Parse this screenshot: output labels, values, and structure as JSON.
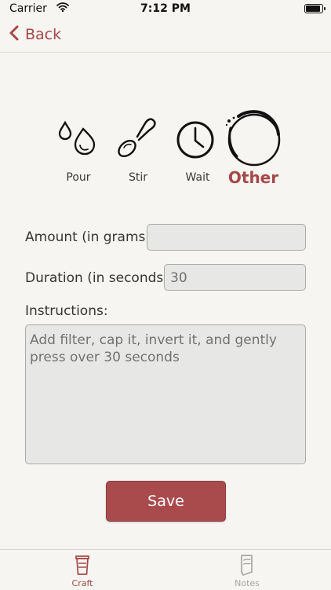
{
  "status_bar": {
    "carrier": "Carrier",
    "time": "7:12 PM"
  },
  "navigation": {
    "back_label": "Back"
  },
  "step_types": [
    {
      "label": "Pour",
      "icon": "drops-icon"
    },
    {
      "label": "Stir",
      "icon": "spoon-icon"
    },
    {
      "label": "Wait",
      "icon": "clock-icon"
    },
    {
      "label": "Other",
      "icon": "coffee-ring-icon",
      "selected": true
    }
  ],
  "form": {
    "amount_label": "Amount (in grams):",
    "amount_value": "",
    "duration_label": "Duration (in seconds):",
    "duration_value": "30",
    "instructions_label": "Instructions:",
    "instructions_value": "Add filter, cap it, invert it, and gently press over 30 seconds"
  },
  "actions": {
    "save_label": "Save"
  },
  "tabs": [
    {
      "label": "Craft",
      "active": true
    },
    {
      "label": "Notes",
      "active": false
    }
  ],
  "colors": {
    "accent": "#a54849",
    "background": "#f6f5f1",
    "field": "#e7e8e6"
  }
}
